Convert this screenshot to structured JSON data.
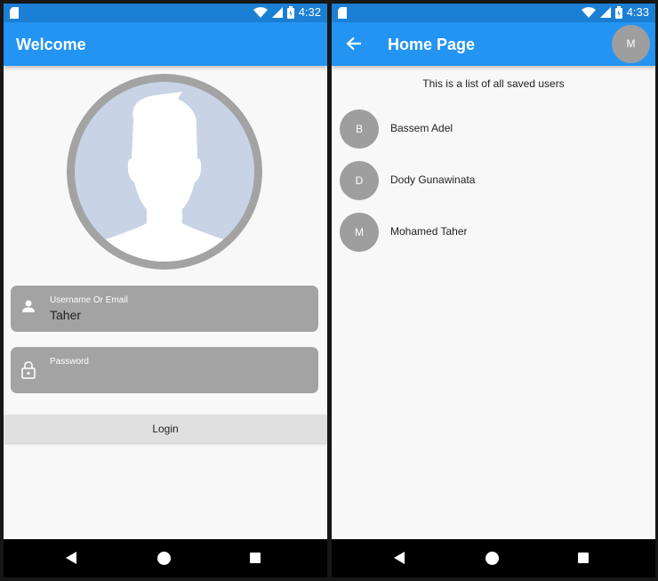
{
  "colors": {
    "appbar": "#2394f2",
    "statusbar": "#1b7fd6",
    "field": "#a3a3a3",
    "avatar": "#9e9e9e"
  },
  "login_screen": {
    "status": {
      "time": "4:32"
    },
    "title": "Welcome",
    "username_field": {
      "label": "Username Or Email",
      "value": "Taher",
      "icon": "person-icon"
    },
    "password_field": {
      "label": "Password",
      "value": "",
      "icon": "lock-icon"
    },
    "login_button": "Login"
  },
  "home_screen": {
    "status": {
      "time": "4:33"
    },
    "title": "Home Page",
    "profile_initial": "M",
    "subtitle": "This is a list of all saved users",
    "users": [
      {
        "initial": "B",
        "name": "Bassem Adel"
      },
      {
        "initial": "D",
        "name": "Dody Gunawinata"
      },
      {
        "initial": "M",
        "name": "Mohamed Taher"
      }
    ]
  }
}
